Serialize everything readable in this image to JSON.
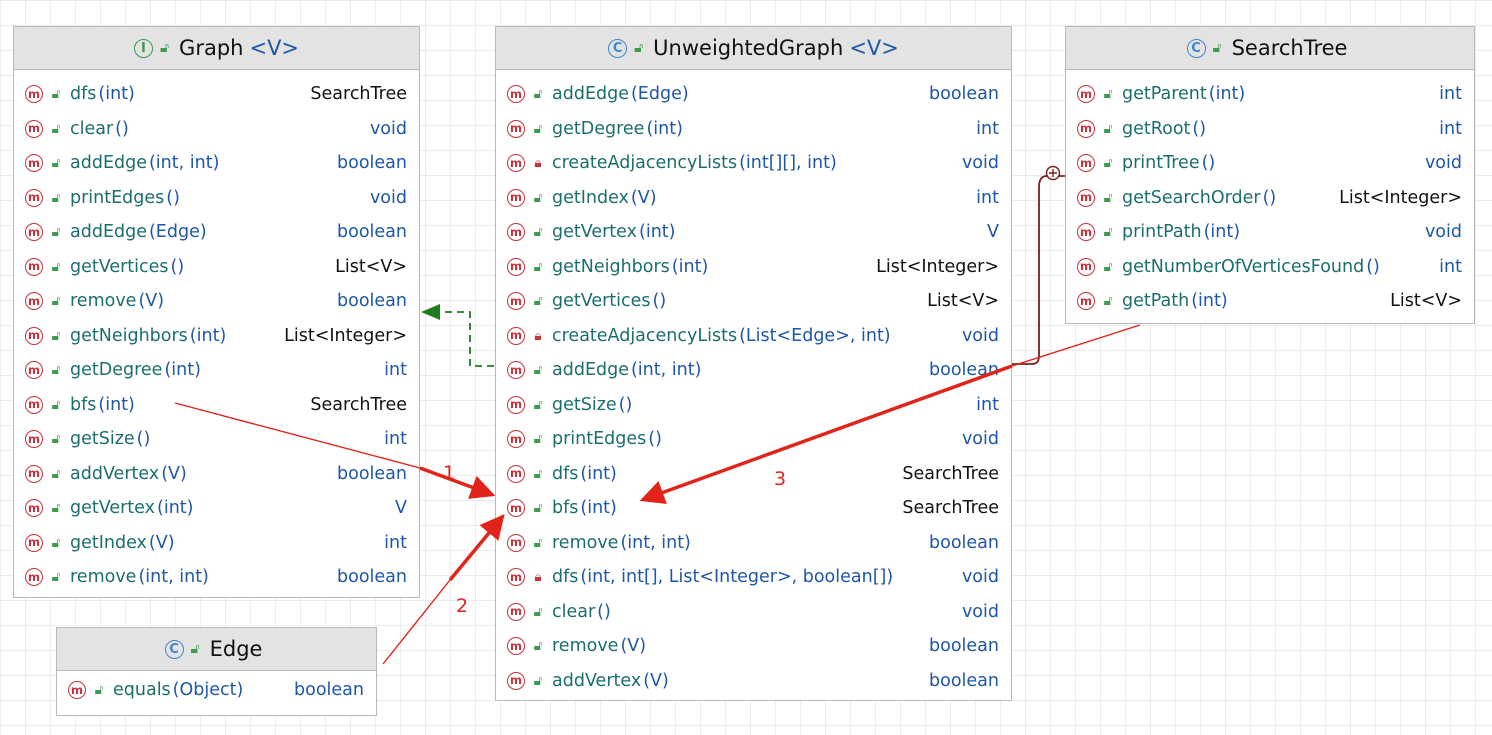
{
  "classes": {
    "graph": {
      "kind_icon": "I",
      "name": "Graph",
      "type_param": "<V>",
      "methods": [
        {
          "name": "dfs",
          "params": "(int)",
          "ret": "SearchTree",
          "vis": "public"
        },
        {
          "name": "clear",
          "params": "()",
          "ret": "void",
          "vis": "public"
        },
        {
          "name": "addEdge",
          "params": "(int, int)",
          "ret": "boolean",
          "vis": "public"
        },
        {
          "name": "printEdges",
          "params": "()",
          "ret": "void",
          "vis": "public"
        },
        {
          "name": "addEdge",
          "params": "(Edge)",
          "ret": "boolean",
          "vis": "public"
        },
        {
          "name": "getVertices",
          "params": "()",
          "ret": "List<V>",
          "vis": "public"
        },
        {
          "name": "remove",
          "params": "(V)",
          "ret": "boolean",
          "vis": "public"
        },
        {
          "name": "getNeighbors",
          "params": "(int)",
          "ret": "List<Integer>",
          "vis": "public"
        },
        {
          "name": "getDegree",
          "params": "(int)",
          "ret": "int",
          "vis": "public"
        },
        {
          "name": "bfs",
          "params": "(int)",
          "ret": "SearchTree",
          "vis": "public"
        },
        {
          "name": "getSize",
          "params": "()",
          "ret": "int",
          "vis": "public"
        },
        {
          "name": "addVertex",
          "params": "(V)",
          "ret": "boolean",
          "vis": "public"
        },
        {
          "name": "getVertex",
          "params": "(int)",
          "ret": "V",
          "vis": "public"
        },
        {
          "name": "getIndex",
          "params": "(V)",
          "ret": "int",
          "vis": "public"
        },
        {
          "name": "remove",
          "params": "(int, int)",
          "ret": "boolean",
          "vis": "public"
        }
      ]
    },
    "unweighted": {
      "kind_icon": "C",
      "name": "UnweightedGraph",
      "type_param": "<V>",
      "methods": [
        {
          "name": "addEdge",
          "params": "(Edge)",
          "ret": "boolean",
          "vis": "public"
        },
        {
          "name": "getDegree",
          "params": "(int)",
          "ret": "int",
          "vis": "public"
        },
        {
          "name": "createAdjacencyLists",
          "params": "(int[][], int)",
          "ret": "void",
          "vis": "private"
        },
        {
          "name": "getIndex",
          "params": "(V)",
          "ret": "int",
          "vis": "public"
        },
        {
          "name": "getVertex",
          "params": "(int)",
          "ret": "V",
          "vis": "public"
        },
        {
          "name": "getNeighbors",
          "params": "(int)",
          "ret": "List<Integer>",
          "vis": "public"
        },
        {
          "name": "getVertices",
          "params": "()",
          "ret": "List<V>",
          "vis": "public"
        },
        {
          "name": "createAdjacencyLists",
          "params": "(List<Edge>, int)",
          "ret": "void",
          "vis": "private"
        },
        {
          "name": "addEdge",
          "params": "(int, int)",
          "ret": "boolean",
          "vis": "public"
        },
        {
          "name": "getSize",
          "params": "()",
          "ret": "int",
          "vis": "public"
        },
        {
          "name": "printEdges",
          "params": "()",
          "ret": "void",
          "vis": "public"
        },
        {
          "name": "dfs",
          "params": "(int)",
          "ret": "SearchTree",
          "vis": "public"
        },
        {
          "name": "bfs",
          "params": "(int)",
          "ret": "SearchTree",
          "vis": "public"
        },
        {
          "name": "remove",
          "params": "(int, int)",
          "ret": "boolean",
          "vis": "public"
        },
        {
          "name": "dfs",
          "params": "(int, int[], List<Integer>, boolean[])",
          "ret": "void",
          "vis": "private"
        },
        {
          "name": "clear",
          "params": "()",
          "ret": "void",
          "vis": "public"
        },
        {
          "name": "remove",
          "params": "(V)",
          "ret": "boolean",
          "vis": "public"
        },
        {
          "name": "addVertex",
          "params": "(V)",
          "ret": "boolean",
          "vis": "public"
        }
      ]
    },
    "searchtree": {
      "kind_icon": "C",
      "name": "SearchTree",
      "type_param": "",
      "methods": [
        {
          "name": "getParent",
          "params": "(int)",
          "ret": "int",
          "vis": "public"
        },
        {
          "name": "getRoot",
          "params": "()",
          "ret": "int",
          "vis": "public"
        },
        {
          "name": "printTree",
          "params": "()",
          "ret": "void",
          "vis": "public"
        },
        {
          "name": "getSearchOrder",
          "params": "()",
          "ret": "List<Integer>",
          "vis": "public"
        },
        {
          "name": "printPath",
          "params": "(int)",
          "ret": "void",
          "vis": "public"
        },
        {
          "name": "getNumberOfVerticesFound",
          "params": "()",
          "ret": "int",
          "vis": "public"
        },
        {
          "name": "getPath",
          "params": "(int)",
          "ret": "List<V>",
          "vis": "public"
        }
      ]
    },
    "edge": {
      "kind_icon": "C",
      "name": "Edge",
      "type_param": "",
      "methods": [
        {
          "name": "equals",
          "params": "(Object)",
          "ret": "boolean",
          "vis": "public"
        }
      ]
    }
  },
  "icons": {
    "method": "m",
    "public_visibility": "unlock-icon",
    "private_visibility": "lock-icon"
  },
  "annotations": {
    "label_1": "1",
    "label_2": "2",
    "label_3": "3"
  },
  "colors": {
    "annotation_arrow": "#e2231a",
    "realization_arrow": "#1e7d1e",
    "inner_class_link": "#7a1f1f",
    "header_bg": "#e3e3e3",
    "type_blue": "#1f57a8",
    "method_teal": "#1b6e6e"
  }
}
